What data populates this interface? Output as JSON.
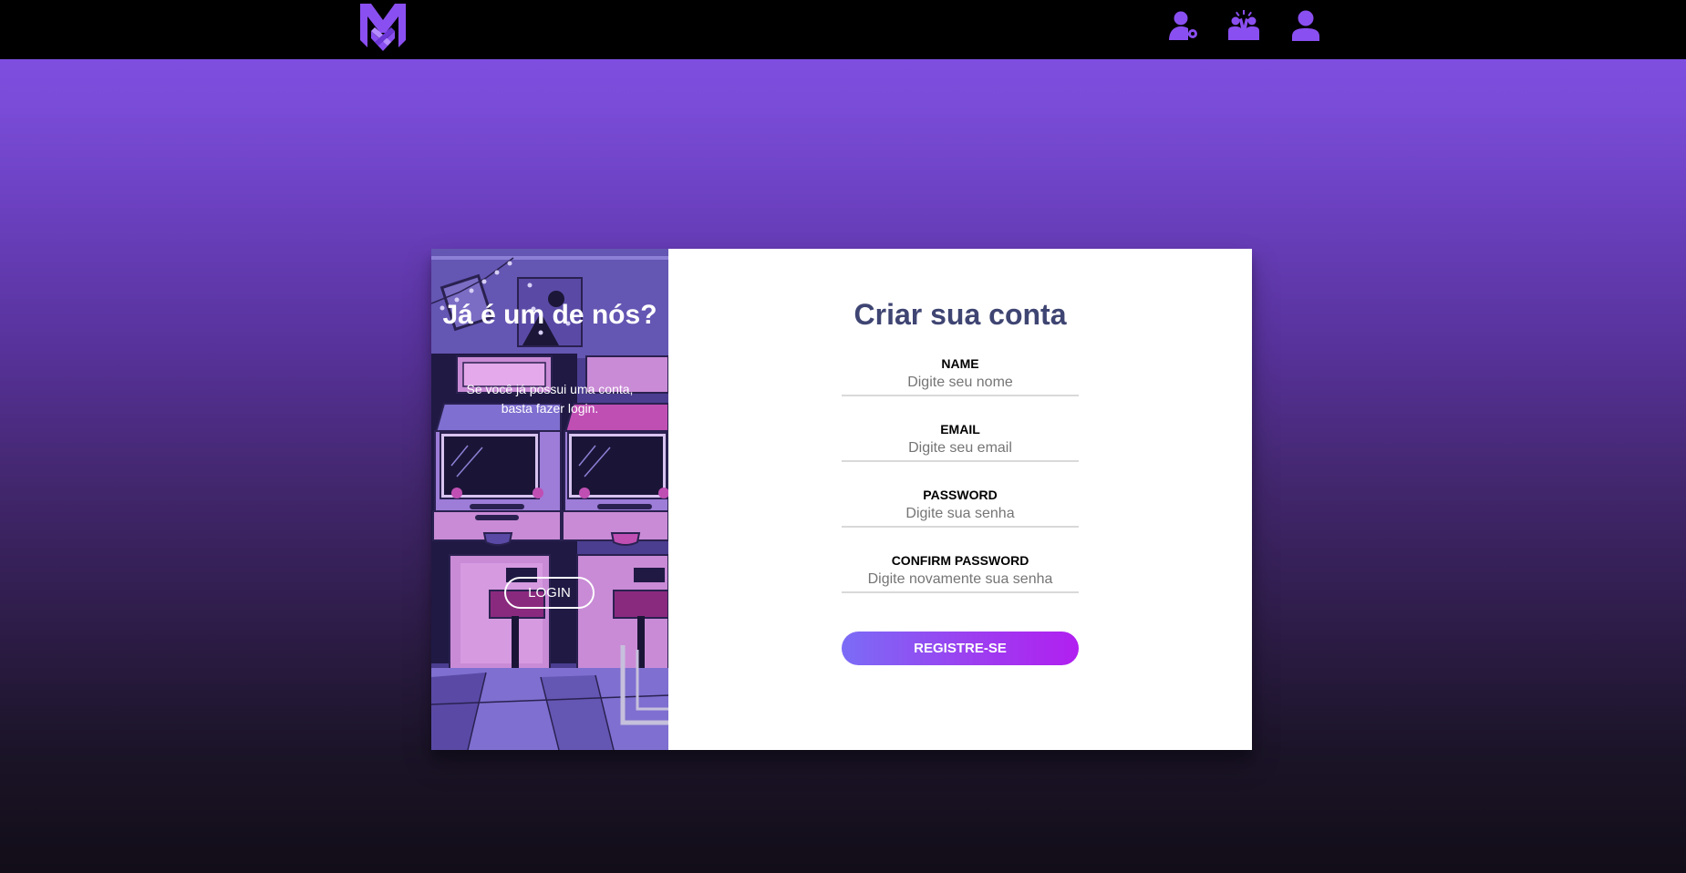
{
  "header": {
    "logo": "logo-icon",
    "icons": [
      "user-key-icon",
      "community-icon",
      "user-icon"
    ],
    "accent_color": "#8a4ff0"
  },
  "overlay": {
    "title": "Já é um de nós?",
    "text": "Se você já possui uma conta, basta fazer login.",
    "login_label": "LOGIN"
  },
  "form": {
    "title": "Criar sua conta",
    "fields": [
      {
        "label": "NAME",
        "placeholder": "Digite seu nome"
      },
      {
        "label": "EMAIL",
        "placeholder": "Digite seu email"
      },
      {
        "label": "PASSWORD",
        "placeholder": "Digite sua senha"
      },
      {
        "label": "CONFIRM PASSWORD",
        "placeholder": "Digite novamente sua senha"
      }
    ],
    "submit_label": "REGISTRE-SE"
  }
}
